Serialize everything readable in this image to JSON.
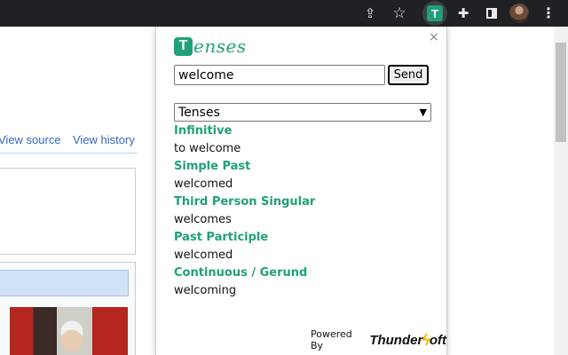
{
  "popup": {
    "logo_text": "enses",
    "logo_badge": "T",
    "close_symbol": "×",
    "input": {
      "value": "welcome"
    },
    "send_label": "Send",
    "select": {
      "selected": "Tenses"
    },
    "results": [
      {
        "label": "Infinitive",
        "value": "to welcome"
      },
      {
        "label": "Simple Past",
        "value": "welcomed"
      },
      {
        "label": "Third Person Singular",
        "value": "welcomes"
      },
      {
        "label": "Past Participle",
        "value": "welcomed"
      },
      {
        "label": "Continuous / Gerund",
        "value": "welcoming"
      }
    ],
    "powered_by": "Powered By",
    "brand_left": "Thunder",
    "brand_right": "oft"
  },
  "toolbar": {
    "active_extension_badge": "T",
    "icons": [
      "share-icon",
      "star-icon",
      "tenses-extension-icon",
      "extensions-puzzle-icon",
      "side-panel-icon",
      "profile-avatar",
      "menu-icon"
    ]
  },
  "page": {
    "tabs": [
      "View source",
      "View history"
    ]
  },
  "colors": {
    "accent": "#20a07a",
    "toolbar": "#202124",
    "link": "#3366cc"
  }
}
